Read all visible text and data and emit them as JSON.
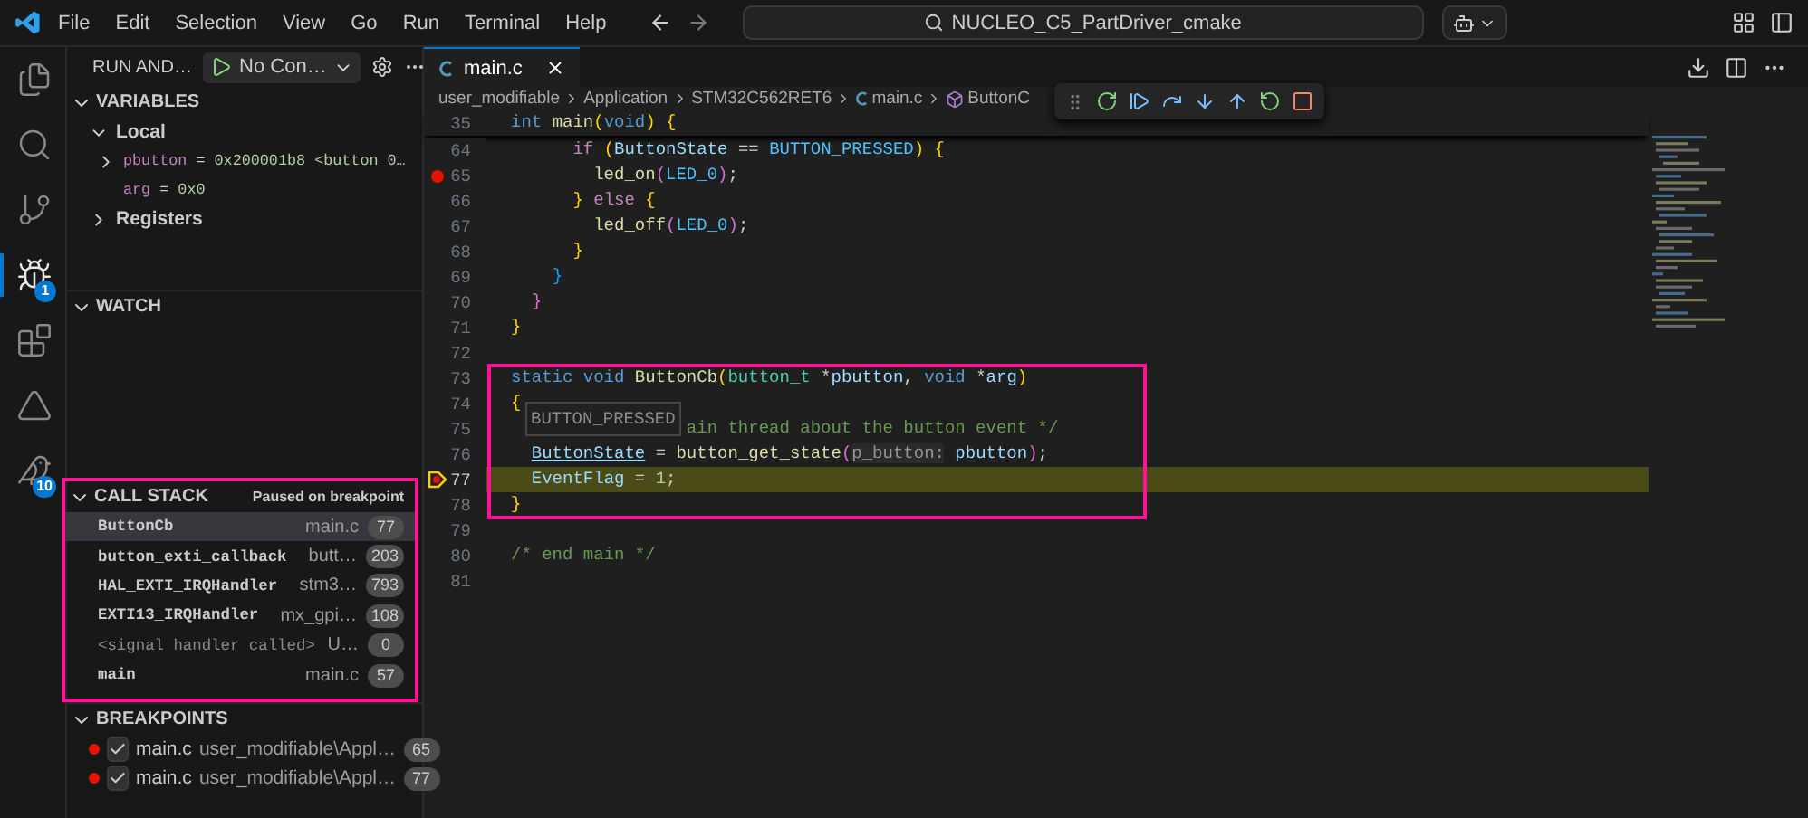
{
  "title_bar": {
    "menus": [
      "File",
      "Edit",
      "Selection",
      "View",
      "Go",
      "Run",
      "Terminal",
      "Help"
    ],
    "search": "NUCLEO_C5_PartDriver_cmake"
  },
  "activity_bar": [
    {
      "kind": "files",
      "selected": false
    },
    {
      "kind": "search",
      "selected": false
    },
    {
      "kind": "source-control",
      "selected": false
    },
    {
      "kind": "debug",
      "selected": true,
      "badge": "1"
    },
    {
      "kind": "extensions",
      "selected": false
    },
    {
      "kind": "triangle",
      "selected": false
    },
    {
      "kind": "bird",
      "selected": false,
      "badge": "10"
    }
  ],
  "sidebar": {
    "title": "RUN AND…",
    "config": "No Con…",
    "variables": {
      "title": "VARIABLES",
      "expanded": true,
      "scopes": [
        {
          "name": "Local",
          "expanded": true,
          "children": [
            {
              "name": "pbutton",
              "sep": "=",
              "value": "0x200001b8 <button_0…",
              "expanded": false
            },
            {
              "name": "arg",
              "sep": "=",
              "value": "0x0"
            }
          ]
        },
        {
          "name": "Registers",
          "expanded": false
        }
      ]
    },
    "watch": {
      "title": "WATCH",
      "expanded": true
    },
    "call_stack": {
      "title": "CALL STACK",
      "status": "Paused on breakpoint",
      "expanded": true,
      "highlighted": true,
      "frames": [
        {
          "name": "ButtonCb",
          "file": "main.c",
          "line": "77",
          "selected": true
        },
        {
          "name": "button_exti_callback",
          "file": "butt…",
          "line": "203",
          "selected": false
        },
        {
          "name": "HAL_EXTI_IRQHandler",
          "file": "stm3…",
          "line": "793",
          "selected": false
        },
        {
          "name": "EXTI13_IRQHandler",
          "file": "mx_gpi…",
          "line": "108",
          "selected": false
        },
        {
          "name": "<signal handler called>",
          "file": "U…",
          "line": "0",
          "selected": false,
          "dimmed": true
        },
        {
          "name": "main",
          "file": "main.c",
          "line": "57",
          "selected": false
        }
      ]
    },
    "breakpoints": {
      "title": "BREAKPOINTS",
      "expanded": true,
      "items": [
        {
          "file": "main.c",
          "path": "user_modifiable\\Appl…",
          "line": "65",
          "checked": true
        },
        {
          "file": "main.c",
          "path": "user_modifiable\\Appl…",
          "line": "77",
          "checked": true
        }
      ]
    }
  },
  "editor": {
    "tabs": [
      {
        "label": "main.c",
        "selected": true
      }
    ],
    "breadcrumb": [
      {
        "kind": "folder",
        "text": "user_modifiable"
      },
      {
        "kind": "folder",
        "text": "Application"
      },
      {
        "kind": "folder",
        "text": "STM32C562RET6"
      },
      {
        "kind": "c-file",
        "text": "main.c"
      },
      {
        "kind": "function",
        "text": "ButtonC"
      }
    ],
    "debug_toolbar": [
      {
        "kind": "reset"
      },
      {
        "kind": "continue"
      },
      {
        "kind": "step-over"
      },
      {
        "kind": "step-into"
      },
      {
        "kind": "step-out"
      },
      {
        "kind": "restart"
      },
      {
        "kind": "stop"
      }
    ],
    "sticky": {
      "number": "35",
      "tokens": [
        {
          "kind": "kw",
          "text": "int "
        },
        {
          "kind": "fn",
          "text": "main"
        },
        {
          "kind": "b1",
          "text": "("
        },
        {
          "kind": "kw",
          "text": "void"
        },
        {
          "kind": "b1",
          "text": ") {"
        }
      ]
    },
    "blocks": [
      {
        "highlighted": false,
        "lines": [
          {
            "number": "64",
            "tokens": [
              {
                "kind": "ctrl",
                "text": "      if "
              },
              {
                "kind": "b1",
                "text": "("
              },
              {
                "kind": "var",
                "text": "ButtonState"
              },
              {
                "kind": "p",
                "text": " == "
              },
              {
                "kind": "const",
                "text": "BUTTON_PRESSED"
              },
              {
                "kind": "b1",
                "text": ") {"
              }
            ]
          },
          {
            "number": "65",
            "breakpoint": true,
            "tokens": [
              {
                "kind": "fn",
                "text": "        led_on"
              },
              {
                "kind": "b2",
                "text": "("
              },
              {
                "kind": "const",
                "text": "LED_0"
              },
              {
                "kind": "b2",
                "text": ")"
              },
              {
                "kind": "p",
                "text": ";"
              }
            ]
          },
          {
            "number": "66",
            "tokens": [
              {
                "kind": "b1",
                "text": "      } "
              },
              {
                "kind": "ctrl",
                "text": "else "
              },
              {
                "kind": "b1",
                "text": "{"
              }
            ]
          },
          {
            "number": "67",
            "tokens": [
              {
                "kind": "fn",
                "text": "        led_off"
              },
              {
                "kind": "b2",
                "text": "("
              },
              {
                "kind": "const",
                "text": "LED_0"
              },
              {
                "kind": "b2",
                "text": ")"
              },
              {
                "kind": "p",
                "text": ";"
              }
            ]
          },
          {
            "number": "68",
            "tokens": [
              {
                "kind": "b1",
                "text": "      }"
              }
            ]
          },
          {
            "number": "69",
            "tokens": [
              {
                "kind": "b3",
                "text": "    }"
              }
            ]
          },
          {
            "number": "70",
            "tokens": [
              {
                "kind": "b2",
                "text": "  }"
              }
            ]
          },
          {
            "number": "71",
            "tokens": [
              {
                "kind": "b1",
                "text": "}"
              }
            ]
          },
          {
            "number": "72"
          }
        ]
      },
      {
        "highlighted": true,
        "lines": [
          {
            "number": "73",
            "tokens": [
              {
                "kind": "kw",
                "text": "static void "
              },
              {
                "kind": "fn",
                "text": "ButtonCb"
              },
              {
                "kind": "b1",
                "text": "("
              },
              {
                "kind": "type",
                "text": "button_t"
              },
              {
                "kind": "p",
                "text": " *"
              },
              {
                "kind": "var",
                "text": "pbutton"
              },
              {
                "kind": "p",
                "text": ", "
              },
              {
                "kind": "kw",
                "text": "void"
              },
              {
                "kind": "p",
                "text": " *"
              },
              {
                "kind": "var",
                "text": "arg"
              },
              {
                "kind": "b1",
                "text": ")"
              }
            ]
          },
          {
            "number": "74",
            "tokens": [
              {
                "kind": "b1",
                "text": "{"
              }
            ]
          },
          {
            "number": "75",
            "hover": "BUTTON_PRESSED",
            "tokens": [
              {
                "kind": "cmt",
                "text": "                 ain thread about the button event */"
              }
            ]
          },
          {
            "number": "76",
            "tokens": [
              {
                "kind": "var",
                "text": "  ButtonState",
                "underlined": true
              },
              {
                "kind": "p",
                "text": " = "
              },
              {
                "kind": "fn",
                "text": "button_get_state"
              },
              {
                "kind": "b2",
                "text": "("
              },
              {
                "kind": "hint",
                "text": "p_button:"
              },
              {
                "kind": "var",
                "text": " pbutton"
              },
              {
                "kind": "b2",
                "text": ")"
              },
              {
                "kind": "p",
                "text": ";"
              }
            ]
          },
          {
            "number": "77",
            "current": true,
            "tokens": [
              {
                "kind": "var",
                "text": "  EventFlag"
              },
              {
                "kind": "p",
                "text": " = "
              },
              {
                "kind": "num",
                "text": "1"
              },
              {
                "kind": "p",
                "text": ";"
              }
            ]
          },
          {
            "number": "78",
            "tokens": [
              {
                "kind": "b1",
                "text": "}"
              }
            ]
          }
        ]
      },
      {
        "highlighted": false,
        "lines": [
          {
            "number": "79"
          },
          {
            "number": "80",
            "tokens": [
              {
                "kind": "cmt",
                "text": "/* end main */"
              }
            ]
          },
          {
            "number": "81"
          }
        ]
      }
    ]
  }
}
